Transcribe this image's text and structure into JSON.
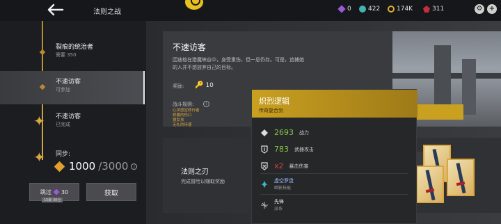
{
  "topbar": {
    "title": "法则之战",
    "resources": [
      {
        "icon": "amethyst-icon",
        "value": "0"
      },
      {
        "icon": "orb-icon",
        "value": "422"
      },
      {
        "icon": "coin-icon",
        "value": "174K"
      },
      {
        "icon": "ruby-icon",
        "value": "311"
      }
    ]
  },
  "timeline": {
    "items": [
      {
        "name": "裂痕的统治者",
        "sub": "需要 350"
      },
      {
        "name": "不速访客",
        "sub": "可参加"
      },
      {
        "name": "不速访客",
        "sub": "已完成"
      }
    ],
    "sync_label": "同步:",
    "sync_current": "1000",
    "sync_total": "/3000",
    "skip_label": "跳过",
    "skip_cost": "30",
    "skip_tag": "15即 30分",
    "claim_label": "获取"
  },
  "mission": {
    "title": "不速访客",
    "description": "因迪格在猎魔峡谷中，身受重伤，但一息仍存。可是，追捕她的人并不想放弃自己的目标。",
    "reward_label": "奖励:",
    "reward_value": "10",
    "rules_label": "战斗规则:",
    "rules": [
      "心灵感应修行者",
      "修魔的伤口",
      "狼女孩",
      "无礼的待使"
    ]
  },
  "reward_card": {
    "title": "法则之刃",
    "subtitle": "完成冒险以赚取奖励"
  },
  "tooltip": {
    "title": "炽烈逻辑",
    "subtitle": "传奇复合剑",
    "stats": [
      {
        "icon": "power-icon",
        "value": "2693",
        "label": "战力"
      },
      {
        "icon": "sword-icon",
        "value": "783",
        "label": "武器攻击"
      },
      {
        "icon": "crit-icon",
        "value": "x2",
        "label": "暴击伤害"
      }
    ],
    "skill": {
      "name": "虚空罗盘",
      "sub": "暗影技能"
    },
    "style": {
      "name": "先锋",
      "sub": "派系"
    }
  },
  "colors": {
    "gold": "#d9a640",
    "tooltip_header": "#c9a020",
    "stat_green": "#8ac34a",
    "crit_red": "#e04040"
  }
}
